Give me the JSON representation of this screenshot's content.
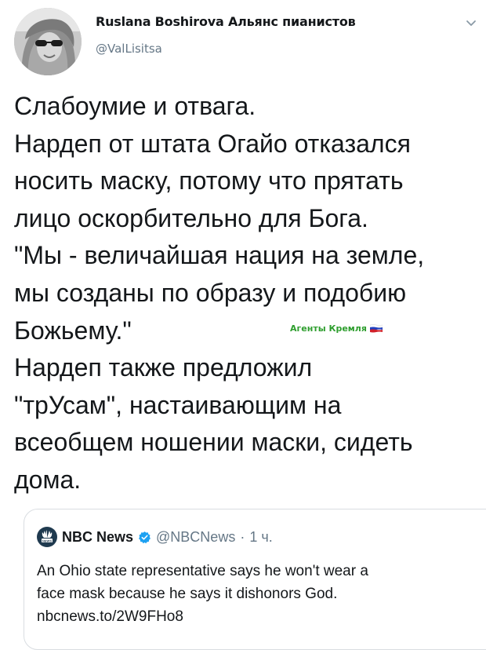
{
  "author": {
    "display_name": "Ruslana Boshirova Альянс пианистов",
    "handle": "@ValLisitsa"
  },
  "tweet": {
    "lines": [
      "Слабоумие и отвага.",
      "Нардеп от штата Огайо отказался",
      "носить маску, потому что прятать",
      "лицо оскорбительно для Бога.",
      "\"Мы - величайшая нация на земле,",
      "мы созданы по образу и подобию",
      "Божьему.\"",
      "Нардеп также предложил",
      "\"трУсам\", настаивающим на",
      "всеобщем ношении маски, сидеть",
      "дома."
    ]
  },
  "watermark": {
    "text": "Агенты Кремля",
    "flag": "russian-flag-icon"
  },
  "quoted_tweet": {
    "name": "NBC News",
    "verified": true,
    "handle": "@NBCNews",
    "separator": "·",
    "time": "1 ч.",
    "lines": [
      "An Ohio state representative says he won't wear a",
      "face mask because he says it dishonors God.",
      "nbcnews.to/2W9FHo8"
    ]
  },
  "colors": {
    "text": "#14171a",
    "secondary": "#657786",
    "verified": "#1da1f2",
    "watermark": "#2e9e2e",
    "border": "#d9dde1"
  },
  "icons": {
    "menu": "chevron-down-icon",
    "verified": "verified-badge-icon",
    "nbc_logo": "nbc-peacock-icon"
  }
}
